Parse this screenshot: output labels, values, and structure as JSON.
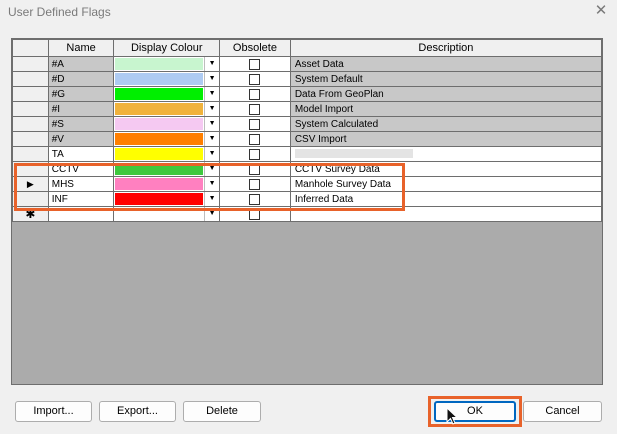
{
  "window": {
    "title": "User Defined Flags",
    "close_glyph": "✕"
  },
  "grid": {
    "headers": [
      "Name",
      "Display Colour",
      "Obsolete",
      "Description"
    ],
    "rows": [
      {
        "name": "#A",
        "color": "#c8f5cf",
        "desc": "Asset Data",
        "kind": "sys",
        "marker": ""
      },
      {
        "name": "#D",
        "color": "#aecbf2",
        "desc": "System Default",
        "kind": "sys",
        "marker": ""
      },
      {
        "name": "#G",
        "color": "#00ef00",
        "desc": "Data From GeoPlan",
        "kind": "sys",
        "marker": ""
      },
      {
        "name": "#I",
        "color": "#f0b23c",
        "desc": "Model Import",
        "kind": "sys",
        "marker": ""
      },
      {
        "name": "#S",
        "color": "#f5c9f2",
        "desc": "System Calculated",
        "kind": "sys",
        "marker": ""
      },
      {
        "name": "#V",
        "color": "#ff7f00",
        "desc": "CSV Import",
        "kind": "sys",
        "marker": ""
      },
      {
        "name": "TA",
        "color": "#ffff00",
        "desc": "",
        "kind": "user",
        "marker": ""
      },
      {
        "name": "CCTV",
        "color": "#3ec83e",
        "desc": "CCTV Survey Data",
        "kind": "user",
        "marker": ""
      },
      {
        "name": "MHS",
        "color": "#ff80c0",
        "desc": "Manhole Survey Data",
        "kind": "user",
        "marker": "▶"
      },
      {
        "name": "INF",
        "color": "#ff0000",
        "desc": "Inferred Data",
        "kind": "user",
        "marker": ""
      }
    ],
    "new_row_marker": "✱"
  },
  "buttons": {
    "import": "Import...",
    "export": "Export...",
    "delete": "Delete",
    "ok": "OK",
    "cancel": "Cancel"
  }
}
